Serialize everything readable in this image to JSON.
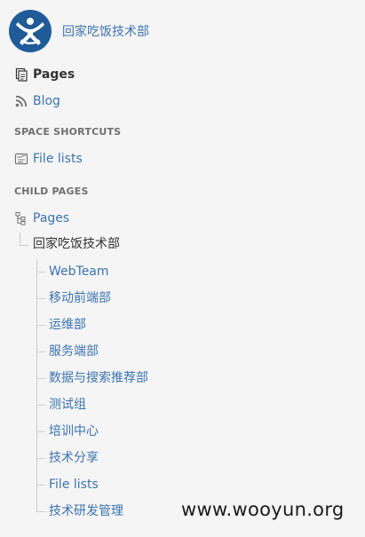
{
  "space": {
    "name": "回家吃饭技术部",
    "logo_icon": "atlassian-confluence-logo"
  },
  "nav": {
    "pages_label": "Pages",
    "blog_label": "Blog"
  },
  "shortcuts": {
    "heading": "SPACE SHORTCUTS",
    "items": [
      {
        "label": "File lists",
        "icon": "file-list-icon"
      }
    ]
  },
  "child_pages": {
    "heading": "CHILD PAGES",
    "root_label": "Pages",
    "parent_label": "回家吃饭技术部",
    "children": [
      {
        "label": "WebTeam"
      },
      {
        "label": "移动前端部"
      },
      {
        "label": "运维部"
      },
      {
        "label": "服务端部"
      },
      {
        "label": "数据与搜索推荐部"
      },
      {
        "label": "测试组"
      },
      {
        "label": "培训中心"
      },
      {
        "label": "技术分享"
      },
      {
        "label": "File lists"
      },
      {
        "label": "技术研发管理"
      }
    ]
  },
  "watermark": "www.wooyun.org",
  "colors": {
    "link": "#3b73af",
    "text": "#333333",
    "heading": "#707070",
    "background": "#f5f5f5",
    "logo_bg": "#1f5c9c"
  }
}
